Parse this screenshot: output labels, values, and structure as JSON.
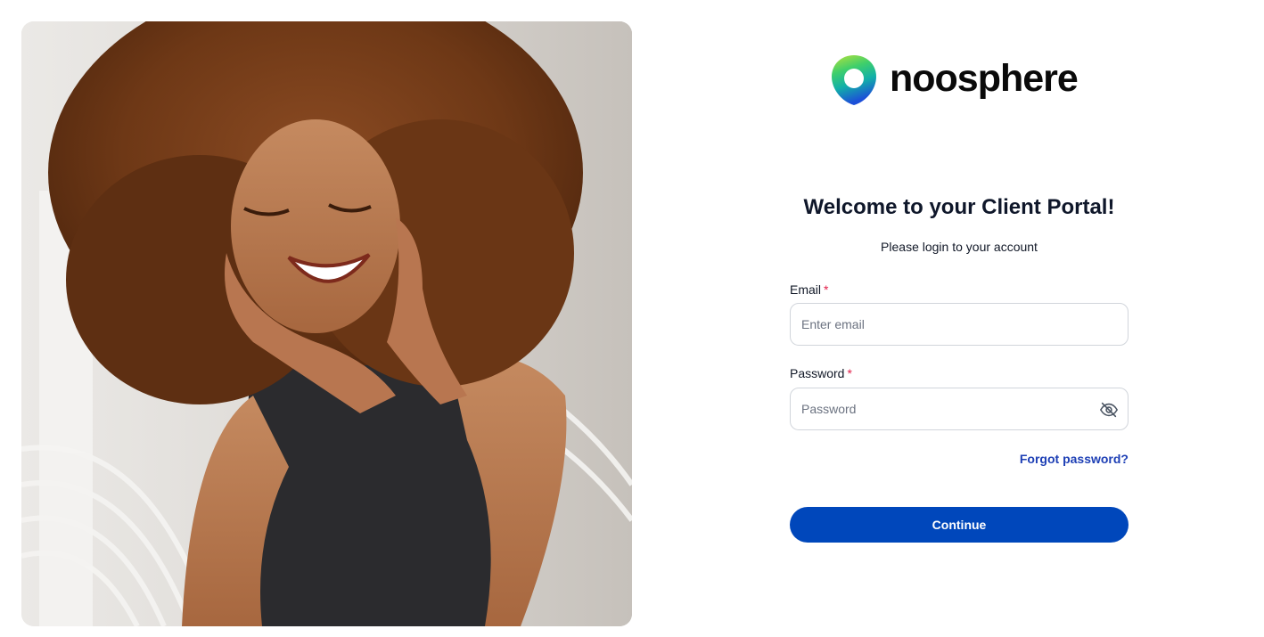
{
  "brand": {
    "name": "noosphere",
    "logo_icon": "brand-drop-ring-icon",
    "colors": {
      "green": "#7ed957",
      "teal": "#11b3a6",
      "blue": "#1c4fd8"
    }
  },
  "hero": {
    "image": "hero-photo"
  },
  "login": {
    "title": "Welcome to your Client Portal!",
    "subtitle": "Please login to your account",
    "email": {
      "label": "Email",
      "required_mark": "*",
      "placeholder": "Enter email",
      "value": ""
    },
    "password": {
      "label": "Password",
      "required_mark": "*",
      "placeholder": "Password",
      "value": "",
      "toggle_icon": "eye-off-icon"
    },
    "forgot_password": "Forgot password?",
    "continue_label": "Continue"
  },
  "colors": {
    "primary": "#0047bb",
    "link": "#1d3fb5",
    "required": "#e11d48",
    "text": "#111827",
    "border": "#d1d5db"
  }
}
